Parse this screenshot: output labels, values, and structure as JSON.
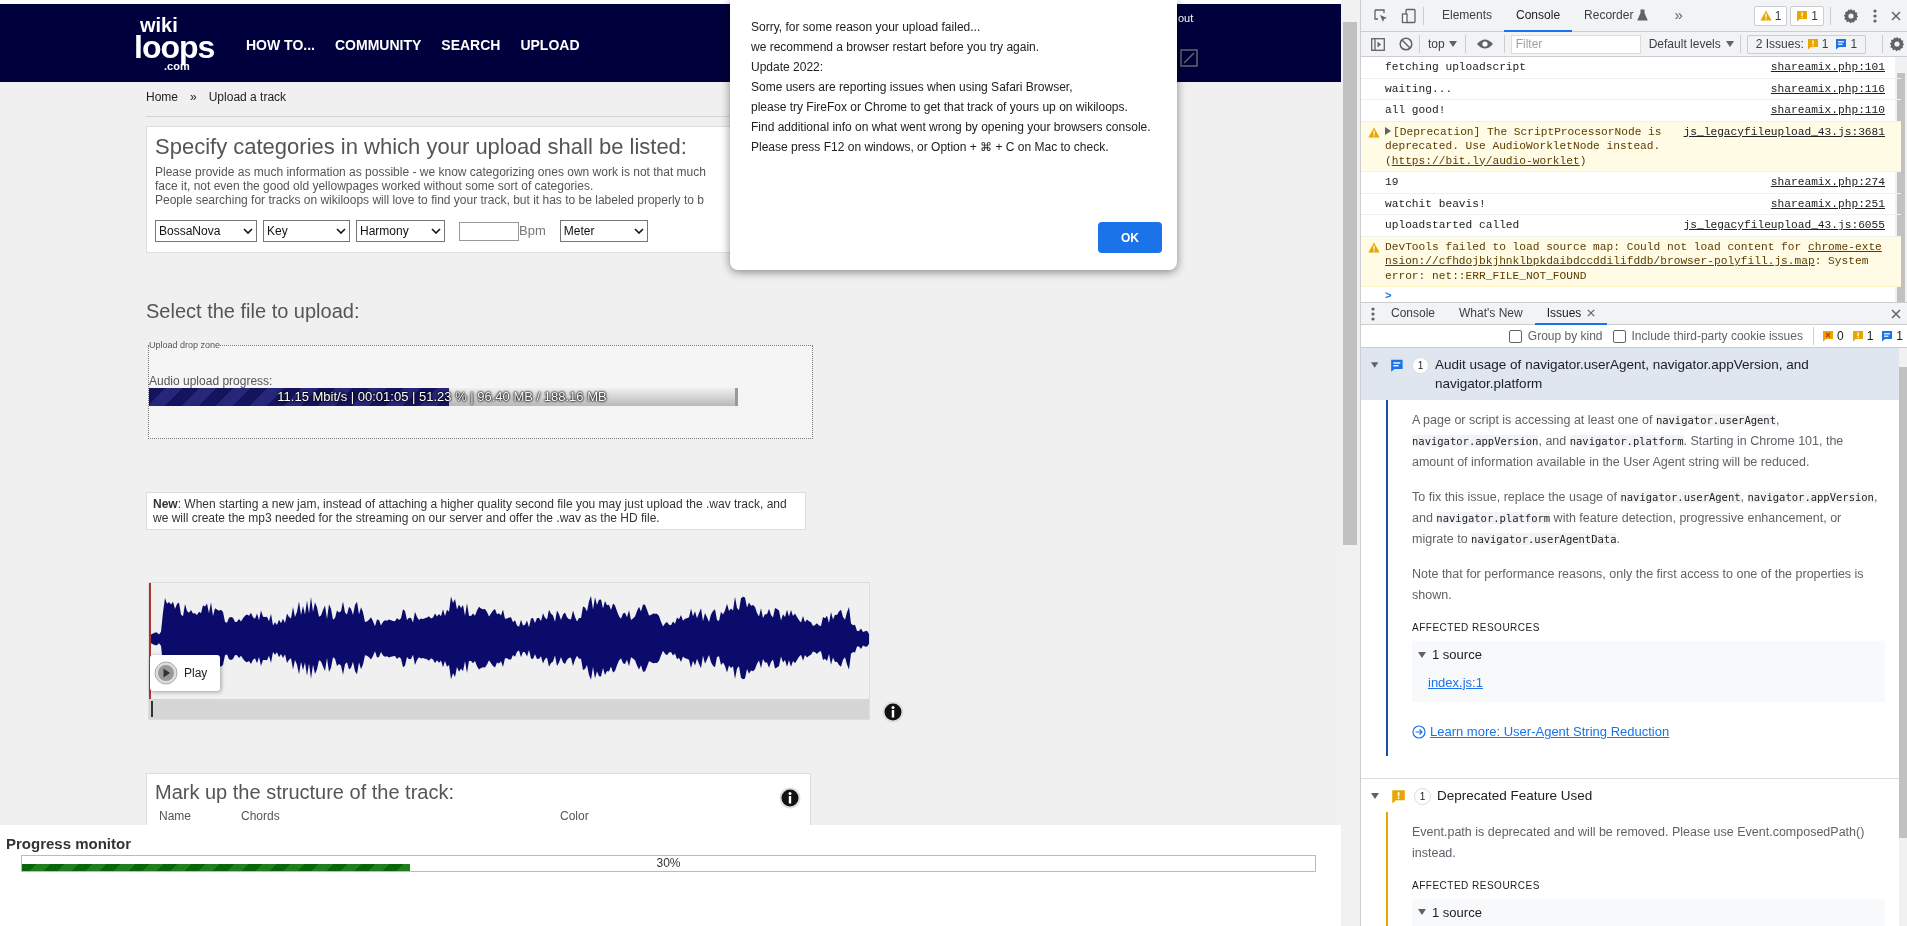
{
  "page": {
    "header": {
      "logo": {
        "top": "wiki",
        "main": "loops",
        "sub": ".com"
      },
      "nav": [
        "HOW TO...",
        "COMMUNITY",
        "SEARCH",
        "UPLOAD"
      ],
      "account_link": "out"
    },
    "breadcrumb": [
      "Home",
      "»",
      "Upload a track"
    ],
    "categories": {
      "title": "Specify categories in which your upload shall be listed:",
      "description": [
        "Please provide as much information as possible - we know categorizing ones own work is not that much",
        "face it, not even the good old yellowpages worked without some sort of categories.",
        "People searching for tracks on wikiloops will love to find your track, but it has to be labeled properly to b"
      ],
      "fields": [
        {
          "kind": "select",
          "value": "BossaNova"
        },
        {
          "kind": "select",
          "value": "Key"
        },
        {
          "kind": "select",
          "value": "Harmony"
        },
        {
          "kind": "number",
          "unit": "Bpm"
        },
        {
          "kind": "select",
          "value": "Meter"
        }
      ]
    },
    "upload": {
      "title": "Select the file to upload:",
      "drop_zone_legend": "Upload drop zone",
      "progress_label": "Audio upload progress:",
      "progress": {
        "level": 0.5123,
        "text": "11.15 Mbit/s | 00:01:05 | 51.23 % | 96.40 MB / 188.16 MB"
      }
    },
    "notice": "**New**: When starting a new jam, instead of attaching a higher quality second file you may just upload the .wav track, and we will create the mp3 needed for the streaming on our server and offer the .wav as the HD file.",
    "player": {
      "play_label": "Play"
    },
    "structure": {
      "title": "Mark up the structure of the track:",
      "columns": [
        "Name",
        "Chords",
        "Color"
      ]
    },
    "progress_monitor": {
      "title": "Progress monitor",
      "level": 0.3,
      "text": "30%"
    },
    "dialog": {
      "lines": [
        "Sorry, for some reason your upload failed...",
        "we recommend a browser restart before you try again.",
        "Update 2022:",
        "Some users are reporting issues when using Safari Browser,",
        "please try FireFox or Chrome to get that track of yours up on wikiloops.",
        "Find additional info on what went wrong by opening your browsers console.",
        "Please press F12 on windows, or Option + ⌘ + C on Mac to check."
      ],
      "button": "OK"
    }
  },
  "devtools": {
    "tabs": [
      {
        "label": "Elements",
        "selected": false,
        "experimental": false
      },
      {
        "label": "Console",
        "selected": true,
        "experimental": false
      },
      {
        "label": "Recorder",
        "selected": false,
        "experimental": true
      }
    ],
    "more_tabs": "»",
    "warning_count": "1",
    "issue_count": "1",
    "console_toolbar": {
      "context": "top",
      "filter_placeholder": "Filter",
      "levels": "Default levels",
      "issues_label": "2 Issues:",
      "issue_counts": [
        "1",
        "1"
      ]
    },
    "messages": [
      {
        "kind": "log",
        "segments": [
          {
            "text": "fetching uploadscript"
          }
        ],
        "source": "shareamix.php:101"
      },
      {
        "kind": "log",
        "segments": [
          {
            "text": "waiting..."
          }
        ],
        "source": "shareamix.php:116"
      },
      {
        "kind": "log",
        "segments": [
          {
            "text": "all good!"
          }
        ],
        "source": "shareamix.php:110"
      },
      {
        "kind": "warning",
        "expandable": true,
        "segments": [
          {
            "text": "[Deprecation] The ScriptProcessorNode is deprecated. Use AudioWorkletNode instead. ("
          },
          {
            "text": "https://bit.ly/audio-worklet",
            "link": true
          },
          {
            "text": ")"
          }
        ],
        "source": "js_legacyfileupload_43.js:3681"
      },
      {
        "kind": "log",
        "segments": [
          {
            "text": "19"
          }
        ],
        "source": "shareamix.php:274"
      },
      {
        "kind": "log",
        "segments": [
          {
            "text": "watchit beavis!"
          }
        ],
        "source": "shareamix.php:251"
      },
      {
        "kind": "log",
        "segments": [
          {
            "text": "uploadstarted called"
          }
        ],
        "source": "js_legacyfileupload_43.js:6055"
      },
      {
        "kind": "warning",
        "expandable": false,
        "segments": [
          {
            "text": "DevTools failed to load source map: Could not load content for "
          },
          {
            "text": "chrome-extension://cfhdojbkjhnklbpkdaibdccddilifddb/browser-polyfill.js.map",
            "link": true
          },
          {
            "text": ": System error: net::ERR_FILE_NOT_FOUND"
          }
        ]
      }
    ],
    "prompt": ">",
    "drawer": {
      "tabs": [
        {
          "label": "Console",
          "selected": false,
          "closable": false
        },
        {
          "label": "What's New",
          "selected": false,
          "closable": false
        },
        {
          "label": "Issues",
          "selected": true,
          "closable": true
        }
      ],
      "options": [
        {
          "label": "Group by kind",
          "checked": false
        },
        {
          "label": "Include third-party cookie issues",
          "checked": false
        }
      ],
      "counts": {
        "errors": "0",
        "warnings": "1",
        "improvements": "1"
      },
      "issues": [
        {
          "kind": "improvement",
          "selected": true,
          "expanded": true,
          "count": "1",
          "title": "Audit usage of navigator.userAgent, navigator.appVersion, and navigator.platform",
          "paragraphs": [
            [
              {
                "text": "A page or script is accessing at least one of "
              },
              {
                "text": "navigator.userAgent",
                "code": true
              },
              {
                "text": ", "
              },
              {
                "text": "navigator.appVersion",
                "code": true
              },
              {
                "text": ", and "
              },
              {
                "text": "navigator.platform",
                "code": true
              },
              {
                "text": ". Starting in Chrome 101, the amount of information available in the User Agent string will be reduced."
              }
            ],
            [
              {
                "text": "To fix this issue, replace the usage of "
              },
              {
                "text": "navigator.userAgent",
                "code": true
              },
              {
                "text": ", "
              },
              {
                "text": "navigator.appVersion",
                "code": true
              },
              {
                "text": ", and "
              },
              {
                "text": "navigator.platform",
                "code": true
              },
              {
                "text": " with feature detection, progressive enhancement, or migrate to "
              },
              {
                "text": "navigator.userAgentData",
                "code": true
              },
              {
                "text": "."
              }
            ],
            [
              {
                "text": "Note that for performance reasons, only the first access to one of the properties is shown."
              }
            ]
          ],
          "affected_label": "AFFECTED RESOURCES",
          "sources": {
            "label": "1 source",
            "expanded": true,
            "links": [
              "index.js:1"
            ]
          },
          "learn_more": "Learn more: User-Agent String Reduction"
        },
        {
          "kind": "warning",
          "selected": false,
          "expanded": true,
          "count": "1",
          "title": "Deprecated Feature Used",
          "paragraphs": [
            [
              {
                "text": "Event.path is deprecated and will be removed. Please use Event.composedPath() instead."
              }
            ]
          ],
          "affected_label": "AFFECTED RESOURCES",
          "sources": {
            "label": "1 source",
            "expanded": true
          }
        }
      ]
    }
  }
}
